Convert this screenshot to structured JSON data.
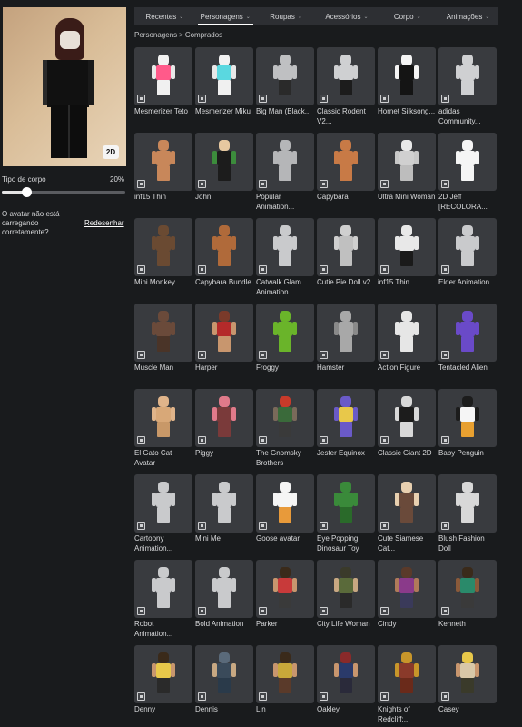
{
  "avatar": {
    "toggle_label": "2D"
  },
  "body_type": {
    "label": "Tipo de corpo",
    "value_text": "20%",
    "value": 0.2
  },
  "notice": {
    "text": "O avatar não está carregando corretamente?",
    "link": "Redesenhar"
  },
  "tabs": [
    {
      "label": "Recentes",
      "active": false
    },
    {
      "label": "Personagens",
      "active": true
    },
    {
      "label": "Roupas",
      "active": false
    },
    {
      "label": "Acessórios",
      "active": false
    },
    {
      "label": "Corpo",
      "active": false
    },
    {
      "label": "Animações",
      "active": false
    }
  ],
  "breadcrumb": {
    "parent": "Personagens",
    "separator": ">",
    "current": "Comprados"
  },
  "items": [
    {
      "name": "Mesmerizer Teto",
      "colors": [
        "#f2f2f2",
        "#ff5a8a",
        "#e8e8e8",
        "#f0f0f0"
      ]
    },
    {
      "name": "Mesmerizer Miku",
      "colors": [
        "#f2f2f2",
        "#5ad8e0",
        "#e8e8e8",
        "#f0f0f0"
      ]
    },
    {
      "name": "Big Man (Black...",
      "colors": [
        "#bfc0c2",
        "#bfc0c2",
        "#bfc0c2",
        "#2a2a2a"
      ]
    },
    {
      "name": "Classic Rodent V2...",
      "colors": [
        "#cfd0d2",
        "#cfd0d2",
        "#cfd0d2",
        "#1c1c1c"
      ]
    },
    {
      "name": "Hornet Silksong...",
      "colors": [
        "#f5f5f5",
        "#141414",
        "#f5f5f5",
        "#141414"
      ]
    },
    {
      "name": "adidas Community...",
      "colors": [
        "#cfd0d2",
        "#cfd0d2",
        "#cfd0d2",
        "#cfd0d2"
      ]
    },
    {
      "name": "inf15 Thin",
      "colors": [
        "#c8875a",
        "#c8875a",
        "#c8875a",
        "#c8875a"
      ]
    },
    {
      "name": "John",
      "colors": [
        "#e6c8a0",
        "#1c1c1c",
        "#3c8c3c",
        "#1c1c1c"
      ]
    },
    {
      "name": "Popular Animation...",
      "colors": [
        "#b5b6b8",
        "#b5b6b8",
        "#b5b6b8",
        "#b5b6b8"
      ]
    },
    {
      "name": "Capybara",
      "colors": [
        "#c87a46",
        "#c87a46",
        "#c87a46",
        "#c87a46"
      ]
    },
    {
      "name": "Ultra Mini Woman",
      "colors": [
        "#e8e8e8",
        "#d0d0d0",
        "#c8c8c8",
        "#bdbdbd"
      ]
    },
    {
      "name": "2D Jeff [RECOLORA...",
      "colors": [
        "#f5f5f5",
        "#f5f5f5",
        "#f5f5f5",
        "#f5f5f5"
      ]
    },
    {
      "name": "Mini Monkey",
      "colors": [
        "#6a4a32",
        "#6a4a32",
        "#6a4a32",
        "#6a4a32"
      ]
    },
    {
      "name": "Capybara Bundle",
      "colors": [
        "#b06a3a",
        "#b06a3a",
        "#b06a3a",
        "#b06a3a"
      ]
    },
    {
      "name": "Catwalk Glam Animation...",
      "colors": [
        "#c9cacc",
        "#c9cacc",
        "#c9cacc",
        "#c9cacc"
      ]
    },
    {
      "name": "Cutie Pie Doll v2",
      "colors": [
        "#cfcfcf",
        "#c0c0c0",
        "#cfcfcf",
        "#c0c0c0"
      ]
    },
    {
      "name": "inf15 Thin",
      "colors": [
        "#e8e8e8",
        "#e8e8e8",
        "#e8e8e8",
        "#1a1a1a"
      ]
    },
    {
      "name": "Elder Animation...",
      "colors": [
        "#c9cacc",
        "#c9cacc",
        "#c9cacc",
        "#c9cacc"
      ]
    },
    {
      "name": "Muscle Man",
      "colors": [
        "#6a4a3a",
        "#6a4a3a",
        "#6a4a3a",
        "#4a3428"
      ]
    },
    {
      "name": "Harper",
      "colors": [
        "#7a3a2a",
        "#b42a2a",
        "#c8966e",
        "#c8966e"
      ]
    },
    {
      "name": "Froggy",
      "colors": [
        "#6ab42a",
        "#6ab42a",
        "#6ab42a",
        "#6ab42a"
      ]
    },
    {
      "name": "Hamster",
      "colors": [
        "#a8a8a8",
        "#a8a8a8",
        "#8a8a8a",
        "#a8a8a8"
      ]
    },
    {
      "name": "Action Figure",
      "colors": [
        "#e6e6e6",
        "#e6e6e6",
        "#e6e6e6",
        "#e6e6e6"
      ]
    },
    {
      "name": "Tentacled Alien",
      "colors": [
        "#6a4ac8",
        "#6a4ac8",
        "#6a4ac8",
        "#6a4ac8"
      ]
    },
    {
      "name": "El Gato Cat Avatar",
      "colors": [
        "#e0b48a",
        "#d8a878",
        "#e0b48a",
        "#c89868"
      ]
    },
    {
      "name": "Piggy",
      "colors": [
        "#e07a8a",
        "#7a3a3a",
        "#e07a8a",
        "#7a3a3a"
      ]
    },
    {
      "name": "The Gnomsky Brothers",
      "colors": [
        "#c83a2a",
        "#3a6a3a",
        "#7a6a5a",
        "#3a3a3a"
      ]
    },
    {
      "name": "Jester Equinox",
      "colors": [
        "#6a5ac8",
        "#e8c84a",
        "#6a5ac8",
        "#6a5ac8"
      ]
    },
    {
      "name": "Classic Giant 2D",
      "colors": [
        "#d8d8d8",
        "#1c1c1c",
        "#d8d8d8",
        "#d8d8d8"
      ]
    },
    {
      "name": "Baby Penguin",
      "colors": [
        "#1c1c1c",
        "#f5f5f5",
        "#1c1c1c",
        "#e8a030"
      ]
    },
    {
      "name": "Cartoony Animation...",
      "colors": [
        "#c9cacc",
        "#c9cacc",
        "#c9cacc",
        "#c9cacc"
      ]
    },
    {
      "name": "Mini Me",
      "colors": [
        "#c9cacc",
        "#c9cacc",
        "#c9cacc",
        "#c9cacc"
      ]
    },
    {
      "name": "Goose avatar",
      "colors": [
        "#f5f5f5",
        "#f5f5f5",
        "#f5f5f5",
        "#e89a3a"
      ]
    },
    {
      "name": "Eye Popping Dinosaur Toy",
      "colors": [
        "#3a8a3a",
        "#3a8a3a",
        "#3a8a3a",
        "#2a6a2a"
      ]
    },
    {
      "name": "Cute Siamese Cat...",
      "colors": [
        "#e8d0b0",
        "#6a4a3a",
        "#e8d0b0",
        "#6a4a3a"
      ]
    },
    {
      "name": "Blush Fashion Doll",
      "colors": [
        "#d8d8d8",
        "#d8d8d8",
        "#d8d8d8",
        "#d8d8d8"
      ]
    },
    {
      "name": "Robot Animation...",
      "colors": [
        "#c9cacc",
        "#c9cacc",
        "#c9cacc",
        "#c9cacc"
      ]
    },
    {
      "name": "Bold Animation",
      "colors": [
        "#c9cacc",
        "#c9cacc",
        "#c9cacc",
        "#c9cacc"
      ]
    },
    {
      "name": "Parker",
      "colors": [
        "#3a2a1a",
        "#c83a3a",
        "#c8966e",
        "#3a3a3a"
      ]
    },
    {
      "name": "City Life Woman",
      "colors": [
        "#3a3a2a",
        "#5a6a3a",
        "#c8a882",
        "#2a2a2a"
      ]
    },
    {
      "name": "Cindy",
      "colors": [
        "#5a3a2a",
        "#8a3a8a",
        "#b07a5a",
        "#3a3a5a"
      ]
    },
    {
      "name": "Kenneth",
      "colors": [
        "#3a2a1a",
        "#2a8a6a",
        "#8a5a3a",
        "#3a3a3a"
      ]
    },
    {
      "name": "Denny",
      "colors": [
        "#3a2a1a",
        "#e8c84a",
        "#c8966e",
        "#2a2a2a"
      ]
    },
    {
      "name": "Dennis",
      "colors": [
        "#5a6a7a",
        "#3a4a5a",
        "#c8a882",
        "#2a3a4a"
      ]
    },
    {
      "name": "Lin",
      "colors": [
        "#3a2a1a",
        "#c8a83a",
        "#c8966e",
        "#5a3a2a"
      ]
    },
    {
      "name": "Oakley",
      "colors": [
        "#8a2a2a",
        "#2a3a6a",
        "#c8966e",
        "#2a2a3a"
      ]
    },
    {
      "name": "Knights of Redcliff:...",
      "colors": [
        "#c8962a",
        "#8a3a2a",
        "#c8962a",
        "#6a2a1a"
      ]
    },
    {
      "name": "Casey",
      "colors": [
        "#e8c84a",
        "#d8c8a8",
        "#c8966e",
        "#3a3a2a"
      ]
    }
  ]
}
